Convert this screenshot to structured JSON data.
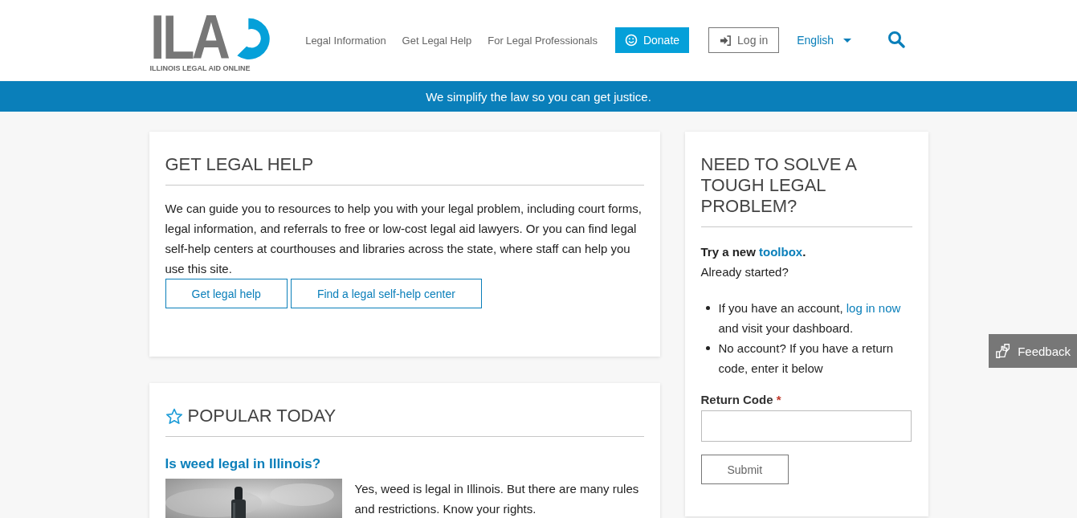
{
  "header": {
    "logo": {
      "mark": "ILA",
      "tagline": "ILLINOIS LEGAL AID ONLINE"
    },
    "nav": [
      {
        "label": "Legal Information"
      },
      {
        "label": "Get Legal Help"
      },
      {
        "label": "For Legal Professionals"
      }
    ],
    "donate": "Donate",
    "login": "Log in",
    "language": "English"
  },
  "banner": "We simplify the law so you can get justice.",
  "help_card": {
    "title": "GET LEGAL HELP",
    "text": "We can guide you to resources to help you with your legal problem, including court forms, legal information, and referrals to free or low-cost legal aid lawyers. Or you can find legal self-help centers at courthouses and libraries across the state, where staff can help you use this site.",
    "buttons": [
      "Get legal help",
      "Find a legal self-help center"
    ]
  },
  "popular_card": {
    "title": "POPULAR TODAY",
    "article": {
      "title": "Is weed legal in Illinois?",
      "summary": "Yes, weed is legal in Illinois. But there are many rules and restrictions. Know your rights."
    }
  },
  "side_card": {
    "title": "NEED TO SOLVE A TOUGH LEGAL PROBLEM?",
    "try_text": "Try a new",
    "try_link": "toolbox",
    "try_end": ".",
    "started": "Already started?",
    "bullets": [
      {
        "text": "If you have an account, ",
        "link": "log in now",
        "after": " and visit your dashboard."
      },
      {
        "text": "No account? If you have a return code, enter it below"
      }
    ],
    "field": {
      "label": "Return Code",
      "required_mark": "*"
    },
    "submit": "Submit"
  },
  "feedback": "Feedback"
}
